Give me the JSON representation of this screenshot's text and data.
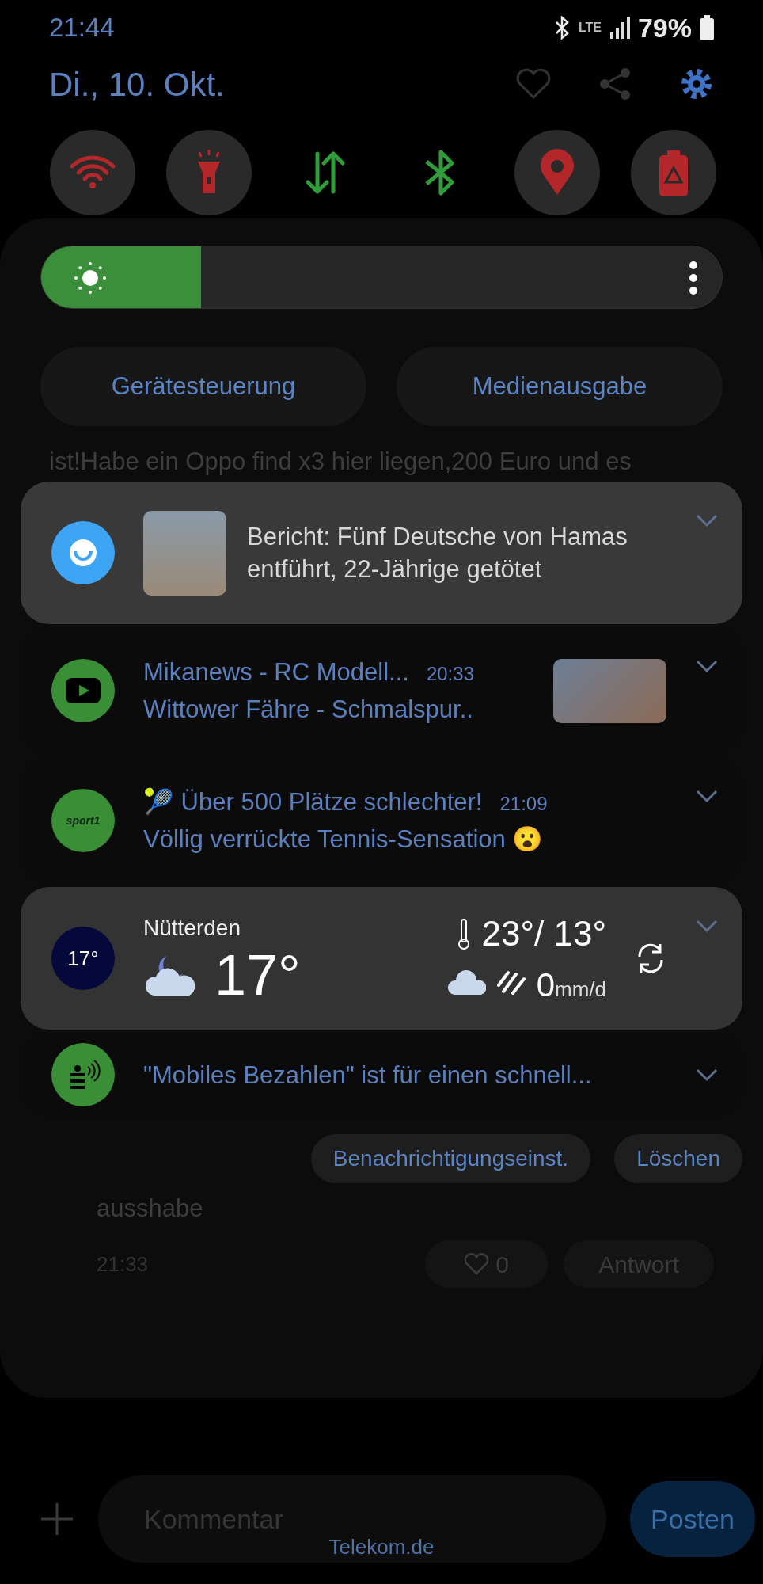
{
  "status_bar": {
    "time": "21:44",
    "network": "LTE",
    "battery": "79%"
  },
  "header": {
    "date": "Di., 10. Okt."
  },
  "quick_tiles": [
    {
      "kind": "wifi",
      "on": false
    },
    {
      "kind": "flashlight",
      "on": false
    },
    {
      "kind": "data",
      "on": true
    },
    {
      "kind": "bluetooth",
      "on": true
    },
    {
      "kind": "location",
      "on": false
    },
    {
      "kind": "power_saving",
      "on": false
    }
  ],
  "brightness": {
    "level": 0.235
  },
  "panel_buttons": [
    "Gerätesteuerung",
    "Medienausgabe"
  ],
  "notifications": [
    {
      "kind": "article",
      "title": "Bericht: Fünf Deutsche von Hamas entführt, 22-Jährige getötet"
    },
    {
      "kind": "media",
      "title": "Mikanews - RC Modell...",
      "time": "20:33",
      "text": "Wittower Fähre - Schmalspur.."
    },
    {
      "kind": "message",
      "app_label": "sport1",
      "title": "🎾 Über 500 Plätze schlechter!",
      "time": "21:09",
      "text": "Völlig verrückte Tennis-Sensation 😮"
    },
    {
      "kind": "weather",
      "app_label": "17°",
      "location": "Nütterden",
      "temperature": "17°",
      "high_low": "23°/ 13°",
      "precipitation": "0",
      "precipitation_unit": "mm/d"
    },
    {
      "kind": "payment",
      "title": "\"Mobiles Bezahlen\" ist für einen schnell..."
    }
  ],
  "footer_buttons": [
    "Benachrichtigungseinst.",
    "Löschen"
  ],
  "background_page": {
    "lines": [
      "ist!Habe ein Oppo find x3 hier liegen,200 Euro und es"
    ],
    "reply_text": "ausshabe",
    "reply_time": "21:33",
    "likes": "0",
    "answer_button": "Antwort",
    "comment_placeholder": "Kommentar",
    "post_button": "Posten"
  },
  "browser_bar": {
    "domain": "Telekom.de"
  }
}
